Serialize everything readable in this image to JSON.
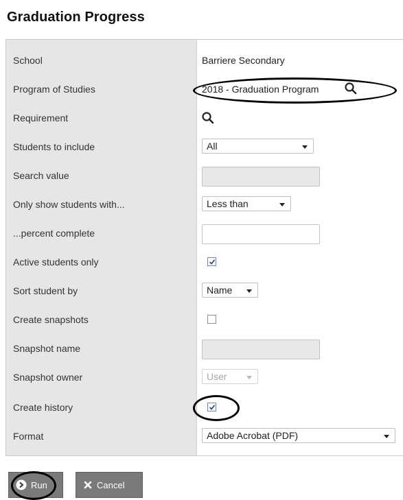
{
  "header": {
    "cut_title": "Graduation Progress (partially visible)",
    "title": "Graduation Progress"
  },
  "form": {
    "school": {
      "label": "School",
      "value": "Barriere Secondary"
    },
    "program": {
      "label": "Program of Studies",
      "value": "2018 - Graduation Program"
    },
    "requirement": {
      "label": "Requirement"
    },
    "students_to_include": {
      "label": "Students to include",
      "value": "All"
    },
    "search_value": {
      "label": "Search value"
    },
    "only_show": {
      "label": "Only show students with...",
      "value": "Less than"
    },
    "percent_complete": {
      "label": "...percent complete"
    },
    "active_only": {
      "label": "Active students only",
      "checked": true
    },
    "sort_by": {
      "label": "Sort student by",
      "value": "Name"
    },
    "create_snapshots": {
      "label": "Create snapshots",
      "checked": false
    },
    "snapshot_name": {
      "label": "Snapshot name"
    },
    "snapshot_owner": {
      "label": "Snapshot owner",
      "value": "User"
    },
    "create_history": {
      "label": "Create history",
      "checked": true
    },
    "format": {
      "label": "Format",
      "value": "Adobe Acrobat (PDF)"
    }
  },
  "actions": {
    "run_label": "Run",
    "cancel_label": "Cancel"
  },
  "icons": {
    "search": "search-icon",
    "run": "run-arrow-icon",
    "cancel": "close-icon"
  },
  "colors": {
    "label_column": "#e6e6e6",
    "button": "#7a7a7a",
    "annotation": "#000000"
  }
}
